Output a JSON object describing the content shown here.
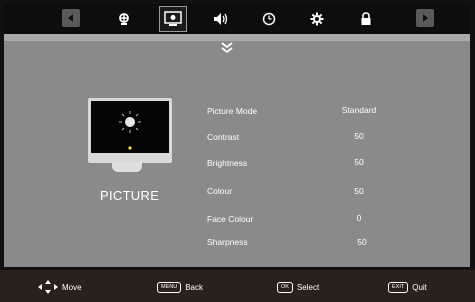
{
  "section_label": "PICTURE",
  "menu_rows": [
    {
      "label": "Picture Mode",
      "value": "Standard"
    },
    {
      "label": "Contrast",
      "value": "50"
    },
    {
      "label": "Brightness",
      "value": "50"
    },
    {
      "label": "Colour",
      "value": "50"
    },
    {
      "label": "Face Colour",
      "value": "0"
    },
    {
      "label": "Sharpness",
      "value": "50"
    }
  ],
  "footer": {
    "move": "Move",
    "back_key": "MENU",
    "back": "Back",
    "select_key": "OK",
    "select": "Select",
    "quit_key": "EXIT",
    "quit": "Quit"
  },
  "tabs": [
    "channel-icon",
    "picture-icon",
    "sound-icon",
    "clock-icon",
    "settings-icon",
    "lock-icon"
  ],
  "colors": {
    "panel": "#8a8a8a",
    "footer": "#2a211d",
    "background": "#000000"
  }
}
